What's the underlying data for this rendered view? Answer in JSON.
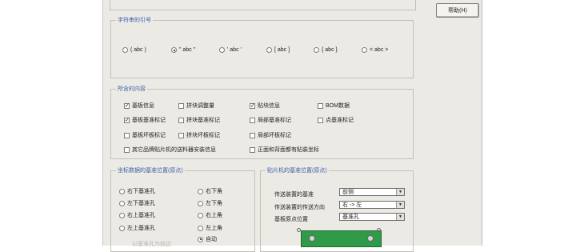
{
  "help_button": "帮助(H)",
  "quote_group": {
    "title": "字符串的引号",
    "options": [
      "( abc )",
      "\" abc \"",
      "' abc '",
      "[ abc ]",
      "{ abc }",
      "< abc >"
    ],
    "selected_index": 1
  },
  "content_group": {
    "title": "所含的内容",
    "items": [
      {
        "label": "基板信息",
        "checked": true
      },
      {
        "label": "拼块调整量",
        "checked": false
      },
      {
        "label": "贴块信息",
        "checked": true
      },
      {
        "label": "BOM数据",
        "checked": false
      },
      {
        "label": "基板基准标记",
        "checked": true
      },
      {
        "label": "拼块基准标记",
        "checked": false
      },
      {
        "label": "局部基准标记",
        "checked": false
      },
      {
        "label": "点基准标记",
        "checked": false
      },
      {
        "label": "基板坏板标记",
        "checked": false
      },
      {
        "label": "拼块坏板标记",
        "checked": false
      },
      {
        "label": "局部坏板标记",
        "checked": false
      },
      {
        "label": "其它品牌贴片机的送料器安装信息",
        "checked": false
      },
      {
        "label": "正面和背面都有贴装坐标",
        "checked": false
      }
    ]
  },
  "origin_group": {
    "title": "坐标数据的基准位置(原点)",
    "options": [
      "右下基准孔",
      "右下角",
      "左下基准孔",
      "左下角",
      "右上基准孔",
      "右上角",
      "左上基准孔",
      "左上角",
      "自动"
    ],
    "selected": "自动",
    "hint": "以基准孔为前边"
  },
  "machine_group": {
    "title": "贴片机的基准位置(原点)",
    "rows": [
      {
        "label": "传送装置的基准",
        "value": "前侧"
      },
      {
        "label": "传送装置的传送方向",
        "value": "右 -> 左"
      },
      {
        "label": "基板原点位置",
        "value": "基准孔"
      }
    ],
    "arrow_glyph": "▼"
  }
}
